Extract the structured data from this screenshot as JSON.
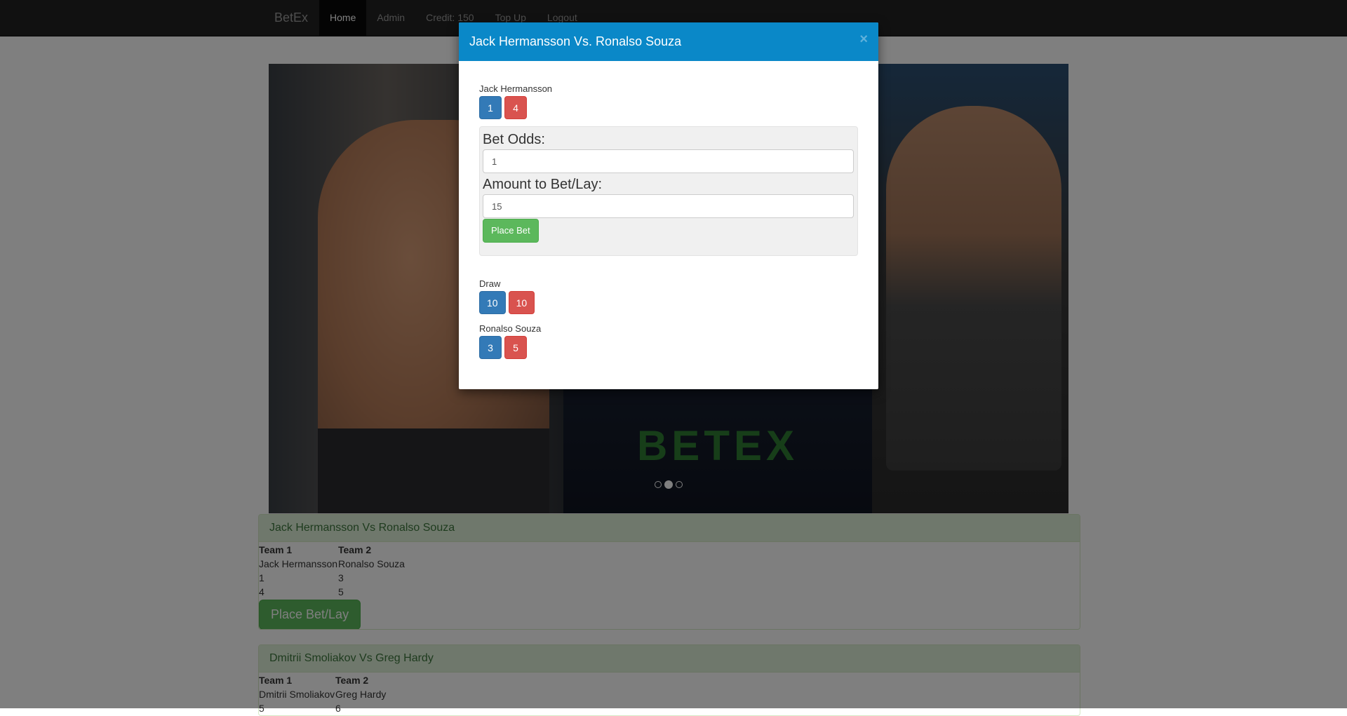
{
  "nav": {
    "brand": "BetEx",
    "items": [
      {
        "label": "Home",
        "active": true
      },
      {
        "label": "Admin"
      },
      {
        "label": "Credit: 150"
      },
      {
        "label": "Top Up"
      },
      {
        "label": "Logout"
      }
    ]
  },
  "carousel": {
    "overlay_text": "BETEX",
    "slides": 3,
    "active_slide": 2
  },
  "events": [
    {
      "title": "Jack Hermansson Vs Ronalso Souza",
      "headers": [
        "Team 1",
        "Team 2"
      ],
      "rows": [
        [
          "Jack Hermansson",
          "Ronalso Souza"
        ],
        [
          "1",
          "3"
        ],
        [
          "4",
          "5"
        ]
      ],
      "button": "Place Bet/Lay"
    },
    {
      "title": "Dmitrii Smoliakov Vs Greg Hardy",
      "headers": [
        "Team 1",
        "Team 2"
      ],
      "rows": [
        [
          "Dmitrii Smoliakov",
          "Greg Hardy"
        ],
        [
          "5",
          "6"
        ]
      ]
    }
  ],
  "modal": {
    "title": "Jack Hermansson Vs. Ronalso Souza",
    "close": "×",
    "selections": [
      {
        "name": "Jack Hermansson",
        "back": "1",
        "lay": "4"
      },
      {
        "name": "Draw",
        "back": "10",
        "lay": "10"
      },
      {
        "name": "Ronalso Souza",
        "back": "3",
        "lay": "5"
      }
    ],
    "form": {
      "odds_label": "Bet Odds:",
      "odds_value": "1",
      "amount_label": "Amount to Bet/Lay:",
      "amount_value": "15",
      "submit": "Place Bet"
    }
  },
  "colors": {
    "modal_header": "#0a88c8",
    "back": "#337ab7",
    "lay": "#d9534f",
    "success": "#5cb85c",
    "panel_heading": "#dff0d8"
  }
}
